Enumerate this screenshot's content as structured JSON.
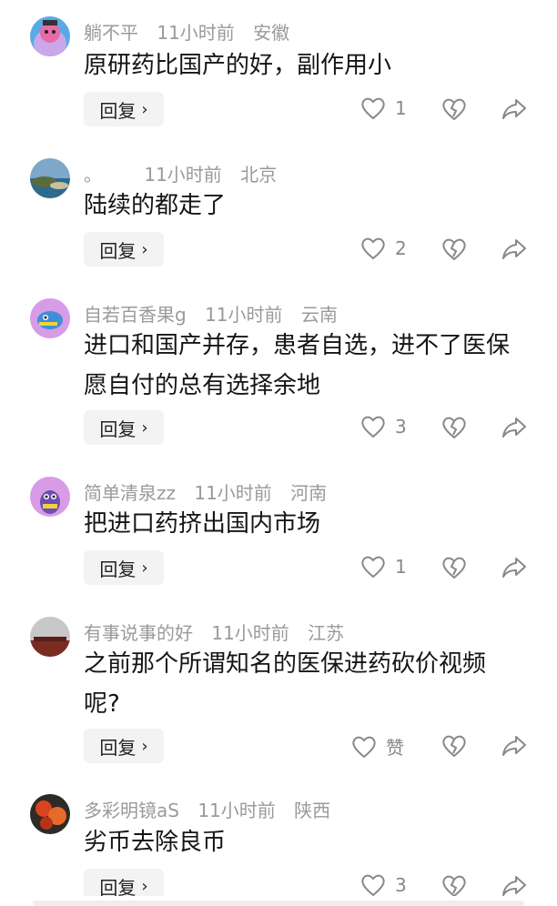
{
  "comments": [
    {
      "name": "躺不平",
      "time": "11小时前",
      "region": "安徽",
      "text": "原研药比国产的好，副作用小",
      "likes": "1"
    },
    {
      "name": "。",
      "time": "11小时前",
      "region": "北京",
      "text": "陆续的都走了",
      "likes": "2"
    },
    {
      "name": "自若百香果g",
      "time": "11小时前",
      "region": "云南",
      "text": "进口和国产并存，患者自选，进不了医保愿自付的总有选择余地",
      "likes": "3"
    },
    {
      "name": "简单清泉zz",
      "time": "11小时前",
      "region": "河南",
      "text": "把进口药挤出国内市场",
      "likes": "1"
    },
    {
      "name": "有事说事的好",
      "time": "11小时前",
      "region": "江苏",
      "text": "之前那个所谓知名的医保进药砍价视频呢?",
      "likes": "赞"
    },
    {
      "name": "多彩明镜aS",
      "time": "11小时前",
      "region": "陕西",
      "text": "劣币去除良币",
      "likes": "3"
    }
  ],
  "reply_label": "回复",
  "chevron": "›",
  "colors": {
    "meta": "#9a9a9a",
    "text": "#151515",
    "icon": "#888888",
    "reply_bg": "#f3f3f3"
  }
}
